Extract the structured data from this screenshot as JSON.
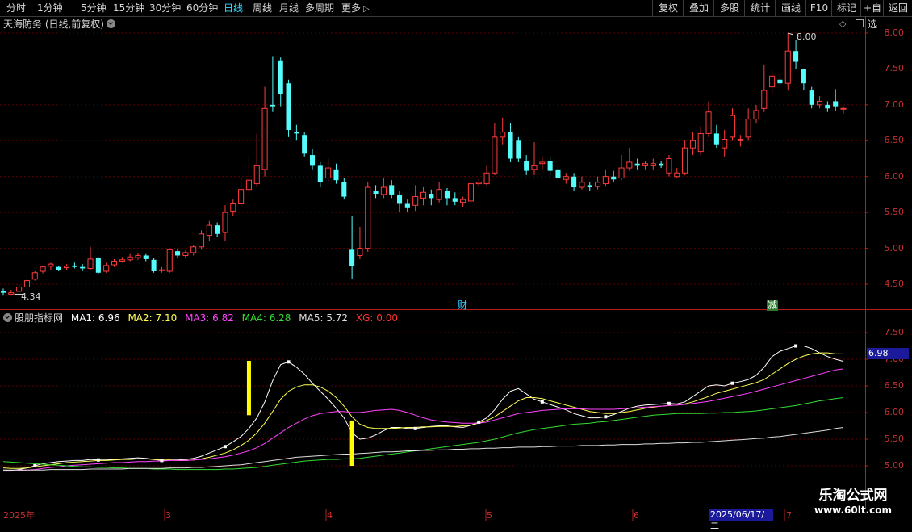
{
  "toolbar": {
    "periods": [
      "分时",
      "1分钟",
      "5分钟",
      "15分钟",
      "30分钟",
      "60分钟",
      "日线",
      "周线",
      "月线",
      "多周期",
      "更多"
    ],
    "active_period": "日线",
    "more_icon": "chevron-right-icon",
    "right_buttons": [
      "复权",
      "叠加",
      "多股",
      "统计",
      "画线",
      "F10",
      "标记",
      "+自选",
      "返回"
    ]
  },
  "main_panel": {
    "title": "天海防务 (日线,前复权)",
    "y_ticks": [
      "8.00",
      "7.50",
      "7.00",
      "6.50",
      "6.00",
      "5.50",
      "5.00",
      "4.50"
    ],
    "high_label": "8.00",
    "low_label": "4.34",
    "markers": [
      "财",
      "减"
    ],
    "colors": {
      "up": "#ff3c3c",
      "down": "#54fcfc",
      "grid": "#5a0000",
      "axis": "#b02020"
    }
  },
  "indicator_panel": {
    "name": "股朋指标网",
    "legend": [
      {
        "label": "MA1: 6.96",
        "color": "#ffffff"
      },
      {
        "label": "MA2: 7.10",
        "color": "#ffff55"
      },
      {
        "label": "MA3: 6.82",
        "color": "#ff44ff"
      },
      {
        "label": "MA4: 6.28",
        "color": "#33dd33"
      },
      {
        "label": "MA5: 5.72",
        "color": "#dddddd"
      },
      {
        "label": "XG: 0.00",
        "color": "#ff3333"
      }
    ],
    "y_ticks": [
      "7.50",
      "7.00",
      "6.50",
      "6.00",
      "5.50",
      "5.00"
    ],
    "current_value": "6.98"
  },
  "x_axis": {
    "labels": [
      "2025年",
      "3",
      "4",
      "5",
      "6",
      "7"
    ],
    "cursor_date": "2025/06/17/二"
  },
  "watermark": {
    "name": "乐淘公式网",
    "url": "www.60lt.com"
  },
  "chart_data": {
    "type": "candlestick",
    "title": "天海防务 (日线,前复权)",
    "ylim": [
      4.2,
      8.1
    ],
    "candles": [
      [
        4.4,
        4.38,
        4.44,
        4.34
      ],
      [
        4.36,
        4.38,
        4.42,
        4.34
      ],
      [
        4.4,
        4.46,
        4.5,
        4.38
      ],
      [
        4.46,
        4.55,
        4.58,
        4.43
      ],
      [
        4.57,
        4.66,
        4.68,
        4.55
      ],
      [
        4.68,
        4.74,
        4.76,
        4.65
      ],
      [
        4.75,
        4.78,
        4.8,
        4.7
      ],
      [
        4.74,
        4.7,
        4.76,
        4.68
      ],
      [
        4.73,
        4.75,
        4.78,
        4.7
      ],
      [
        4.76,
        4.74,
        4.8,
        4.72
      ],
      [
        4.74,
        4.72,
        4.78,
        4.68
      ],
      [
        4.72,
        4.85,
        5.02,
        4.7
      ],
      [
        4.86,
        4.66,
        4.88,
        4.64
      ],
      [
        4.68,
        4.76,
        4.8,
        4.66
      ],
      [
        4.77,
        4.82,
        4.85,
        4.74
      ],
      [
        4.82,
        4.84,
        4.88,
        4.8
      ],
      [
        4.84,
        4.88,
        4.92,
        4.82
      ],
      [
        4.87,
        4.9,
        4.94,
        4.84
      ],
      [
        4.9,
        4.85,
        4.92,
        4.82
      ],
      [
        4.84,
        4.68,
        4.86,
        4.66
      ],
      [
        4.7,
        4.7,
        4.74,
        4.66
      ],
      [
        4.68,
        4.98,
        5.0,
        4.66
      ],
      [
        4.96,
        4.9,
        5.0,
        4.86
      ],
      [
        4.9,
        4.94,
        4.97,
        4.86
      ],
      [
        4.94,
        5.02,
        5.05,
        4.9
      ],
      [
        5.02,
        5.2,
        5.25,
        4.98
      ],
      [
        5.18,
        5.32,
        5.38,
        5.1
      ],
      [
        5.32,
        5.2,
        5.36,
        5.16
      ],
      [
        5.22,
        5.5,
        5.6,
        5.1
      ],
      [
        5.52,
        5.62,
        5.68,
        5.45
      ],
      [
        5.62,
        5.82,
        6.0,
        5.58
      ],
      [
        5.82,
        5.95,
        6.3,
        5.75
      ],
      [
        5.9,
        6.15,
        6.6,
        5.85
      ],
      [
        6.1,
        6.95,
        7.25,
        6.0
      ],
      [
        7.0,
        6.98,
        7.68,
        6.9
      ],
      [
        7.62,
        7.15,
        7.66,
        6.98
      ],
      [
        7.3,
        6.65,
        7.35,
        6.55
      ],
      [
        6.62,
        6.6,
        6.72,
        6.5
      ],
      [
        6.58,
        6.32,
        6.62,
        6.28
      ],
      [
        6.3,
        6.15,
        6.38,
        6.1
      ],
      [
        6.15,
        5.92,
        6.2,
        5.85
      ],
      [
        5.98,
        6.12,
        6.25,
        5.92
      ],
      [
        6.1,
        5.95,
        6.18,
        5.9
      ],
      [
        5.92,
        5.72,
        5.98,
        5.68
      ],
      [
        4.98,
        4.75,
        5.45,
        4.58
      ],
      [
        4.9,
        5.0,
        5.3,
        4.85
      ],
      [
        5.0,
        5.85,
        5.92,
        4.95
      ],
      [
        5.8,
        5.76,
        5.88,
        5.7
      ],
      [
        5.75,
        5.85,
        5.98,
        5.7
      ],
      [
        5.88,
        5.75,
        5.95,
        5.7
      ],
      [
        5.75,
        5.62,
        5.8,
        5.5
      ],
      [
        5.62,
        5.56,
        5.68,
        5.5
      ],
      [
        5.6,
        5.72,
        5.88,
        5.52
      ],
      [
        5.7,
        5.78,
        5.85,
        5.6
      ],
      [
        5.76,
        5.7,
        5.82,
        5.6
      ],
      [
        5.68,
        5.82,
        5.92,
        5.64
      ],
      [
        5.8,
        5.7,
        5.84,
        5.6
      ],
      [
        5.7,
        5.65,
        5.78,
        5.6
      ],
      [
        5.64,
        5.68,
        5.72,
        5.58
      ],
      [
        5.66,
        5.9,
        5.95,
        5.62
      ],
      [
        5.9,
        5.92,
        5.96,
        5.86
      ],
      [
        5.9,
        6.05,
        6.15,
        5.88
      ],
      [
        6.05,
        6.55,
        6.75,
        6.02
      ],
      [
        6.55,
        6.62,
        6.82,
        6.45
      ],
      [
        6.62,
        6.25,
        6.75,
        6.2
      ],
      [
        6.5,
        6.25,
        6.55,
        6.2
      ],
      [
        6.22,
        6.08,
        6.3,
        6.02
      ],
      [
        6.1,
        6.15,
        6.48,
        6.02
      ],
      [
        6.18,
        6.2,
        6.28,
        6.1
      ],
      [
        6.22,
        6.08,
        6.28,
        6.02
      ],
      [
        6.1,
        5.98,
        6.15,
        5.92
      ],
      [
        5.96,
        6.0,
        6.05,
        5.9
      ],
      [
        6.0,
        5.85,
        6.05,
        5.8
      ],
      [
        5.85,
        5.92,
        6.0,
        5.82
      ],
      [
        5.88,
        5.85,
        5.92,
        5.8
      ],
      [
        5.86,
        5.92,
        6.0,
        5.82
      ],
      [
        5.9,
        6.0,
        6.1,
        5.86
      ],
      [
        6.0,
        5.96,
        6.08,
        5.92
      ],
      [
        5.98,
        6.12,
        6.3,
        5.95
      ],
      [
        6.12,
        6.2,
        6.4,
        6.08
      ],
      [
        6.18,
        6.15,
        6.25,
        6.1
      ],
      [
        6.15,
        6.18,
        6.22,
        6.1
      ],
      [
        6.15,
        6.18,
        6.25,
        6.1
      ],
      [
        6.18,
        6.15,
        6.22,
        6.12
      ],
      [
        6.05,
        6.25,
        6.3,
        6.0
      ],
      [
        6.0,
        6.05,
        6.12,
        5.98
      ],
      [
        6.05,
        6.4,
        6.5,
        6.02
      ],
      [
        6.4,
        6.5,
        6.62,
        6.3
      ],
      [
        6.35,
        6.6,
        6.7,
        6.3
      ],
      [
        6.6,
        6.9,
        7.05,
        6.55
      ],
      [
        6.6,
        6.45,
        6.72,
        6.4
      ],
      [
        6.4,
        6.52,
        6.65,
        6.28
      ],
      [
        6.55,
        6.85,
        6.95,
        6.5
      ],
      [
        6.5,
        6.52,
        6.58,
        6.42
      ],
      [
        6.55,
        6.8,
        6.95,
        6.5
      ],
      [
        6.8,
        6.92,
        7.0,
        6.75
      ],
      [
        6.95,
        7.2,
        7.55,
        6.9
      ],
      [
        7.25,
        7.4,
        7.48,
        7.15
      ],
      [
        7.35,
        7.3,
        7.42,
        7.28
      ],
      [
        7.3,
        7.75,
        8.0,
        7.2
      ],
      [
        7.75,
        7.6,
        7.9,
        7.5
      ],
      [
        7.5,
        7.3,
        7.5,
        7.2
      ],
      [
        7.2,
        7.0,
        7.25,
        6.95
      ],
      [
        7.0,
        7.05,
        7.12,
        6.95
      ],
      [
        7.0,
        6.95,
        7.05,
        6.9
      ],
      [
        7.05,
        6.98,
        7.22,
        6.92
      ],
      [
        6.95,
        6.95,
        6.98,
        6.88
      ]
    ],
    "indicator": {
      "ylim": [
        4.85,
        7.8
      ],
      "series": [
        {
          "name": "MA1",
          "color": "#ffffff",
          "values": [
            4.92,
            4.91,
            4.93,
            4.96,
            5.0,
            5.04,
            5.06,
            5.08,
            5.09,
            5.1,
            5.1,
            5.12,
            5.11,
            5.11,
            5.12,
            5.13,
            5.14,
            5.15,
            5.14,
            5.12,
            5.1,
            5.11,
            5.11,
            5.12,
            5.14,
            5.18,
            5.24,
            5.3,
            5.36,
            5.45,
            5.55,
            5.7,
            5.9,
            6.2,
            6.6,
            6.9,
            6.95,
            6.85,
            6.72,
            6.55,
            6.4,
            6.25,
            6.08,
            5.9,
            5.62,
            5.5,
            5.52,
            5.58,
            5.66,
            5.72,
            5.72,
            5.7,
            5.7,
            5.72,
            5.74,
            5.75,
            5.75,
            5.73,
            5.72,
            5.76,
            5.82,
            5.9,
            6.05,
            6.25,
            6.4,
            6.45,
            6.35,
            6.25,
            6.2,
            6.15,
            6.1,
            6.05,
            5.98,
            5.94,
            5.9,
            5.9,
            5.92,
            5.96,
            6.02,
            6.08,
            6.12,
            6.14,
            6.15,
            6.16,
            6.17,
            6.16,
            6.2,
            6.3,
            6.4,
            6.5,
            6.52,
            6.5,
            6.55,
            6.58,
            6.62,
            6.7,
            6.85,
            7.05,
            7.15,
            7.2,
            7.25,
            7.25,
            7.2,
            7.12,
            7.05,
            7.0,
            6.96
          ]
        },
        {
          "name": "MA2",
          "color": "#ffff55",
          "values": [
            4.96,
            4.95,
            4.95,
            4.96,
            4.98,
            5.0,
            5.02,
            5.04,
            5.06,
            5.07,
            5.08,
            5.09,
            5.1,
            5.1,
            5.11,
            5.12,
            5.12,
            5.13,
            5.13,
            5.12,
            5.11,
            5.11,
            5.1,
            5.1,
            5.11,
            5.13,
            5.16,
            5.2,
            5.24,
            5.3,
            5.38,
            5.48,
            5.62,
            5.8,
            6.02,
            6.25,
            6.4,
            6.48,
            6.52,
            6.52,
            6.48,
            6.4,
            6.28,
            6.12,
            5.92,
            5.78,
            5.72,
            5.7,
            5.7,
            5.7,
            5.71,
            5.72,
            5.72,
            5.73,
            5.73,
            5.74,
            5.74,
            5.74,
            5.75,
            5.76,
            5.8,
            5.85,
            5.92,
            6.02,
            6.12,
            6.22,
            6.28,
            6.28,
            6.26,
            6.22,
            6.18,
            6.14,
            6.1,
            6.06,
            6.02,
            6.0,
            5.98,
            5.98,
            6.0,
            6.02,
            6.05,
            6.08,
            6.1,
            6.12,
            6.13,
            6.14,
            6.16,
            6.2,
            6.25,
            6.3,
            6.36,
            6.4,
            6.44,
            6.48,
            6.52,
            6.56,
            6.62,
            6.72,
            6.82,
            6.92,
            7.0,
            7.06,
            7.1,
            7.12,
            7.12,
            7.1,
            7.1
          ]
        },
        {
          "name": "MA3",
          "color": "#ff44ff",
          "values": [
            4.9,
            4.9,
            4.91,
            4.92,
            4.93,
            4.95,
            4.97,
            4.98,
            5.0,
            5.01,
            5.02,
            5.03,
            5.04,
            5.05,
            5.06,
            5.06,
            5.07,
            5.08,
            5.08,
            5.09,
            5.09,
            5.1,
            5.1,
            5.1,
            5.11,
            5.12,
            5.13,
            5.15,
            5.17,
            5.2,
            5.24,
            5.28,
            5.34,
            5.42,
            5.52,
            5.62,
            5.72,
            5.8,
            5.88,
            5.94,
            5.98,
            6.0,
            6.02,
            6.02,
            6.0,
            6.0,
            6.02,
            6.04,
            6.05,
            6.06,
            6.04,
            6.0,
            5.95,
            5.9,
            5.86,
            5.84,
            5.82,
            5.81,
            5.8,
            5.8,
            5.8,
            5.82,
            5.86,
            5.9,
            5.94,
            5.98,
            6.0,
            6.02,
            6.04,
            6.05,
            6.06,
            6.07,
            6.07,
            6.07,
            6.06,
            6.06,
            6.06,
            6.06,
            6.07,
            6.08,
            6.09,
            6.1,
            6.11,
            6.12,
            6.13,
            6.14,
            6.15,
            6.17,
            6.19,
            6.21,
            6.24,
            6.27,
            6.3,
            6.33,
            6.36,
            6.4,
            6.44,
            6.48,
            6.52,
            6.56,
            6.6,
            6.64,
            6.68,
            6.72,
            6.76,
            6.8,
            6.82
          ]
        },
        {
          "name": "MA4",
          "color": "#33dd33",
          "values": [
            5.08,
            5.07,
            5.06,
            5.05,
            5.04,
            5.03,
            5.02,
            5.01,
            5.0,
            4.99,
            4.98,
            4.98,
            4.97,
            4.97,
            4.96,
            4.96,
            4.95,
            4.95,
            4.95,
            4.94,
            4.94,
            4.94,
            4.93,
            4.93,
            4.93,
            4.93,
            4.93,
            4.93,
            4.94,
            4.94,
            4.95,
            4.96,
            4.97,
            4.99,
            5.01,
            5.03,
            5.05,
            5.07,
            5.09,
            5.1,
            5.11,
            5.12,
            5.12,
            5.13,
            5.13,
            5.14,
            5.16,
            5.18,
            5.2,
            5.22,
            5.24,
            5.26,
            5.28,
            5.3,
            5.32,
            5.34,
            5.36,
            5.38,
            5.4,
            5.42,
            5.44,
            5.47,
            5.5,
            5.54,
            5.58,
            5.62,
            5.65,
            5.68,
            5.7,
            5.72,
            5.74,
            5.76,
            5.78,
            5.79,
            5.8,
            5.82,
            5.83,
            5.85,
            5.87,
            5.89,
            5.91,
            5.93,
            5.95,
            5.96,
            5.97,
            5.98,
            5.98,
            5.98,
            5.98,
            5.99,
            5.99,
            6.0,
            6.0,
            6.01,
            6.02,
            6.03,
            6.05,
            6.07,
            6.09,
            6.11,
            6.13,
            6.16,
            6.19,
            6.22,
            6.24,
            6.26,
            6.28
          ]
        },
        {
          "name": "MA5",
          "color": "#dddddd",
          "values": [
            4.92,
            4.92,
            4.92,
            4.92,
            4.92,
            4.92,
            4.93,
            4.93,
            4.93,
            4.93,
            4.93,
            4.94,
            4.94,
            4.94,
            4.94,
            4.94,
            4.95,
            4.95,
            4.95,
            4.95,
            4.95,
            4.96,
            4.96,
            4.96,
            4.97,
            4.97,
            4.98,
            4.99,
            5.0,
            5.01,
            5.02,
            5.04,
            5.06,
            5.08,
            5.1,
            5.12,
            5.14,
            5.16,
            5.17,
            5.18,
            5.19,
            5.2,
            5.21,
            5.22,
            5.22,
            5.23,
            5.24,
            5.25,
            5.26,
            5.26,
            5.27,
            5.28,
            5.28,
            5.29,
            5.29,
            5.3,
            5.3,
            5.31,
            5.31,
            5.32,
            5.32,
            5.33,
            5.33,
            5.34,
            5.34,
            5.35,
            5.35,
            5.35,
            5.36,
            5.36,
            5.37,
            5.37,
            5.37,
            5.38,
            5.38,
            5.38,
            5.39,
            5.39,
            5.4,
            5.4,
            5.4,
            5.41,
            5.41,
            5.42,
            5.42,
            5.43,
            5.43,
            5.44,
            5.44,
            5.45,
            5.46,
            5.47,
            5.48,
            5.49,
            5.5,
            5.51,
            5.52,
            5.54,
            5.55,
            5.57,
            5.59,
            5.61,
            5.63,
            5.65,
            5.67,
            5.7,
            5.72
          ]
        }
      ],
      "signals": [
        {
          "index": 31,
          "from": 5.95,
          "to": 6.97
        },
        {
          "index": 44,
          "from": 5.0,
          "to": 5.85
        }
      ]
    }
  }
}
